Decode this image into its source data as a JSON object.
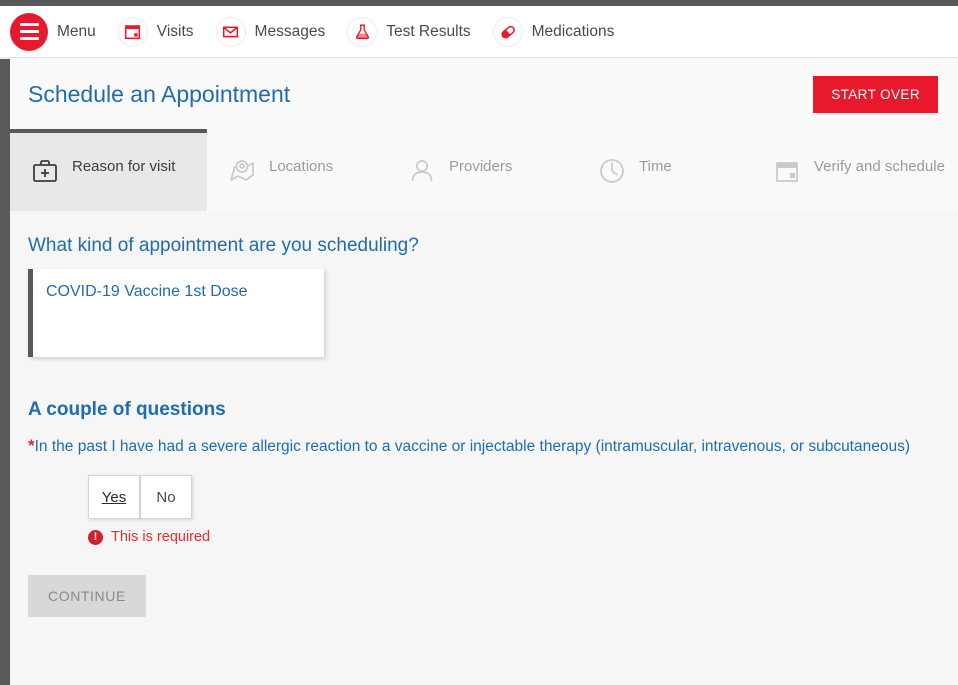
{
  "topnav": {
    "menu_label": "Menu",
    "menu_icon": "hamburger-icon",
    "items": [
      {
        "label": "Visits",
        "icon": "calendar-icon"
      },
      {
        "label": "Messages",
        "icon": "envelope-icon"
      },
      {
        "label": "Test Results",
        "icon": "flask-icon"
      },
      {
        "label": "Medications",
        "icon": "pill-icon"
      }
    ]
  },
  "header": {
    "title": "Schedule an Appointment",
    "start_over_label": "START OVER"
  },
  "steps": [
    {
      "label": "Reason for visit",
      "icon": "medical-bag-icon",
      "active": true
    },
    {
      "label": "Locations",
      "icon": "map-pin-icon",
      "active": false
    },
    {
      "label": "Providers",
      "icon": "person-icon",
      "active": false
    },
    {
      "label": "Time",
      "icon": "clock-icon",
      "active": false
    },
    {
      "label": "Verify and schedule",
      "icon": "calendar-icon",
      "active": false
    }
  ],
  "main": {
    "appointment_question": "What kind of appointment are you scheduling?",
    "appointment_card_label": "COVID-19 Vaccine 1st Dose",
    "questions_heading": "A couple of questions",
    "required_marker": "*",
    "question_text": "In the past I have had a severe allergic reaction to a vaccine or injectable therapy (intramuscular, intravenous, or subcutaneous)",
    "yes_label": "Yes",
    "no_label": "No",
    "error_icon_glyph": "!",
    "error_text": "This is required",
    "continue_label": "CONTINUE"
  },
  "colors": {
    "brand_red": "#e8192c",
    "link_blue": "#1f6cb0",
    "dark_gray": "#58595b",
    "error_red": "#e03030",
    "page_bg": "#f6f6f6"
  }
}
